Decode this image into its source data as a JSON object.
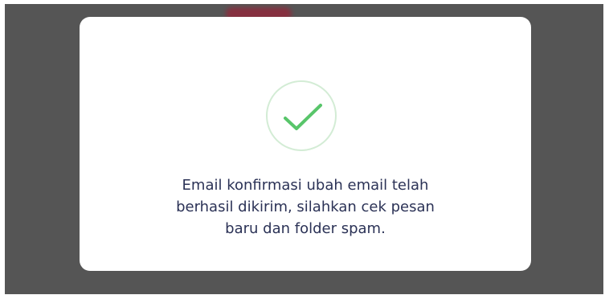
{
  "dialog": {
    "icon": "checkmark-icon",
    "message_lines": [
      "Email konfirmasi ubah email telah",
      "berhasil dikirim, silahkan cek pesan",
      "baru dan folder spam."
    ]
  },
  "colors": {
    "overlay": "#555555",
    "modal_background": "#ffffff",
    "success_green": "#58c56a",
    "badge_ring": "#d3ecd5",
    "text": "#2b3256",
    "background_accent": "#8f2a3c"
  }
}
